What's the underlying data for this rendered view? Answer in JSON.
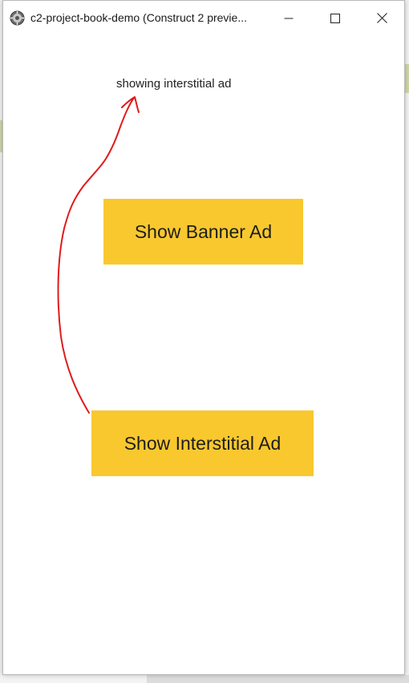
{
  "window": {
    "title": "c2-project-book-demo (Construct 2 previe...",
    "icon": "construct-app-icon",
    "controls": {
      "minimize": "minimize-icon",
      "maximize": "maximize-icon",
      "close": "close-icon"
    }
  },
  "content": {
    "status_text": "showing interstitial ad",
    "banner_button_label": "Show Banner Ad",
    "interstitial_button_label": "Show Interstitial Ad"
  },
  "colors": {
    "button_fill": "#f9c82f",
    "annotation_arrow": "#e01b1b"
  }
}
